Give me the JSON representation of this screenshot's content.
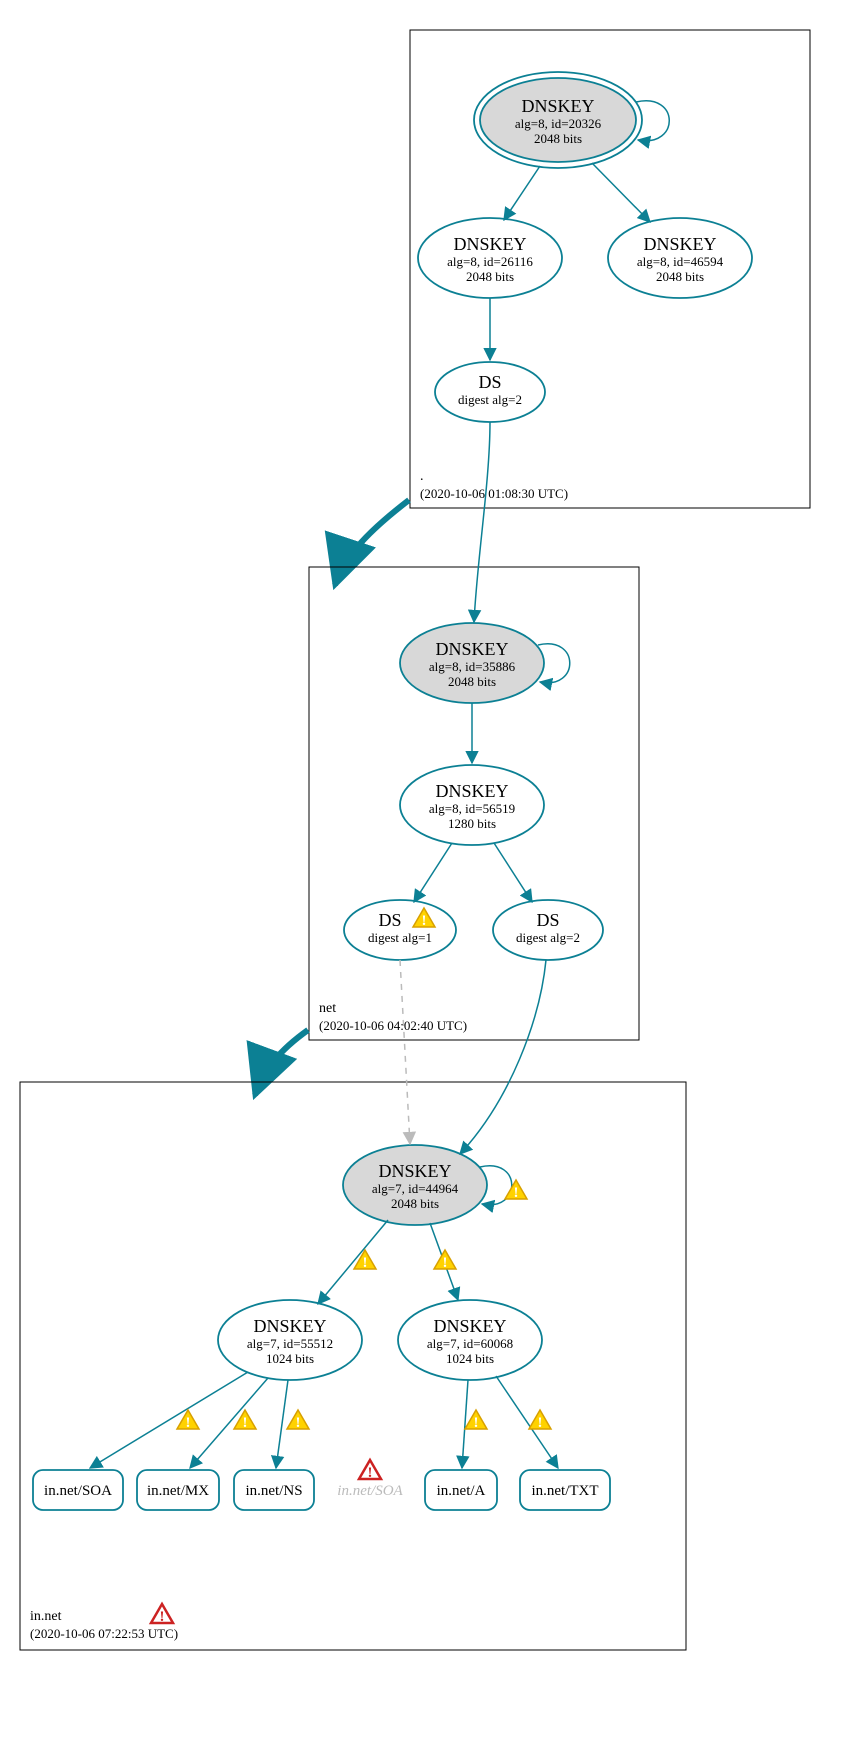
{
  "zone_root": {
    "label": ".",
    "timestamp": "(2020-10-06 01:08:30 UTC)",
    "ksk": {
      "title": "DNSKEY",
      "line1": "alg=8, id=20326",
      "line2": "2048 bits"
    },
    "zsk1": {
      "title": "DNSKEY",
      "line1": "alg=8, id=26116",
      "line2": "2048 bits"
    },
    "zsk2": {
      "title": "DNSKEY",
      "line1": "alg=8, id=46594",
      "line2": "2048 bits"
    },
    "ds": {
      "title": "DS",
      "line1": "digest alg=2"
    }
  },
  "zone_net": {
    "label": "net",
    "timestamp": "(2020-10-06 04:02:40 UTC)",
    "ksk": {
      "title": "DNSKEY",
      "line1": "alg=8, id=35886",
      "line2": "2048 bits"
    },
    "zsk": {
      "title": "DNSKEY",
      "line1": "alg=8, id=56519",
      "line2": "1280 bits"
    },
    "ds1": {
      "title": "DS",
      "line1": "digest alg=1"
    },
    "ds2": {
      "title": "DS",
      "line1": "digest alg=2"
    }
  },
  "zone_in": {
    "label": "in.net",
    "timestamp": "(2020-10-06 07:22:53 UTC)",
    "ksk": {
      "title": "DNSKEY",
      "line1": "alg=7, id=44964",
      "line2": "2048 bits"
    },
    "zsk1": {
      "title": "DNSKEY",
      "line1": "alg=7, id=55512",
      "line2": "1024 bits"
    },
    "zsk2": {
      "title": "DNSKEY",
      "line1": "alg=7, id=60068",
      "line2": "1024 bits"
    },
    "rr": {
      "soa": "in.net/SOA",
      "mx": "in.net/MX",
      "ns": "in.net/NS",
      "soa_ghost": "in.net/SOA",
      "a": "in.net/A",
      "txt": "in.net/TXT"
    }
  }
}
